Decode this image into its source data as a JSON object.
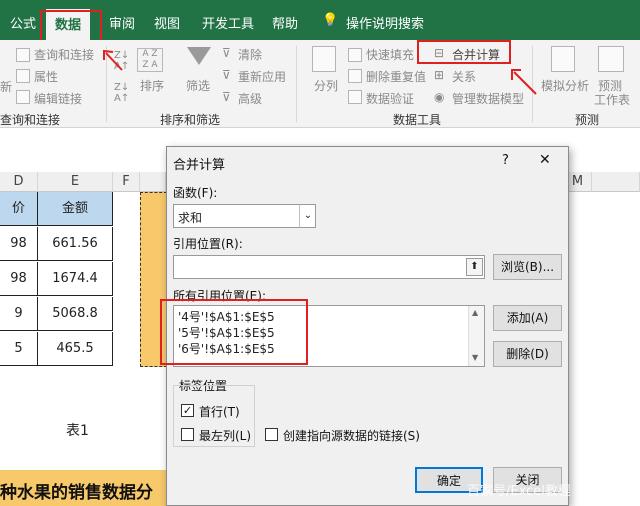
{
  "tabs": [
    {
      "label": "公式"
    },
    {
      "label": "数据"
    },
    {
      "label": "审阅"
    },
    {
      "label": "视图"
    },
    {
      "label": "开发工具"
    },
    {
      "label": "帮助"
    },
    {
      "label": "操作说明搜索"
    }
  ],
  "ribbon": {
    "query": {
      "items": [
        "查询和连接",
        "属性",
        "编辑链接"
      ],
      "group_label": "查询和连接",
      "new_label": "新"
    },
    "sort": {
      "sort_label": "排序",
      "filter_label": "筛选",
      "clear_label": "清除",
      "reapply_label": "重新应用",
      "advanced_label": "高级",
      "group_label": "排序和筛选"
    },
    "tools": {
      "split_label": "分列",
      "flash_fill": "快速填充",
      "remove_dup": "删除重复值",
      "validation": "数据验证",
      "consolidate": "合并计算",
      "relations": "关系",
      "data_model": "管理数据模型",
      "group_label": "数据工具"
    },
    "forecast": {
      "whatif_label": "模拟分析",
      "sheet_label": "预测",
      "sheet_label2": "工作表",
      "group_label": "预测"
    }
  },
  "sheet": {
    "columns": [
      "D",
      "E",
      "F",
      "M"
    ],
    "header_d": "价",
    "header_e": "金额",
    "rows": [
      {
        "d": "98",
        "e": "661.56"
      },
      {
        "d": "98",
        "e": "1674.4"
      },
      {
        "d": "9",
        "e": "5068.8"
      },
      {
        "d": "5",
        "e": "465.5"
      }
    ],
    "table_caption": "表1",
    "title_text": "种水果的销售数据分"
  },
  "dialog": {
    "title": "合并计算",
    "help": "?",
    "close": "✕",
    "function_label": "函数(F):",
    "function_value": "求和",
    "ref_label": "引用位置(R):",
    "ref_value": "",
    "browse_label": "浏览(B)...",
    "all_refs_label": "所有引用位置(E):",
    "all_refs": [
      "'4号'!$A$1:$E$5",
      "'5号'!$A$1:$E$5",
      "'6号'!$A$1:$E$5"
    ],
    "add_label": "添加(A)",
    "delete_label": "删除(D)",
    "label_position": "标签位置",
    "top_row": "首行(T)",
    "top_row_checked": true,
    "left_column": "最左列(L)",
    "left_column_checked": false,
    "link_source": "创建指向源数据的链接(S)",
    "link_source_checked": false,
    "ok_label": "确定",
    "close_label": "关闭"
  },
  "watermark": "百家号/Excel教程",
  "colors": {
    "accent": "#217346",
    "highlight": "#e02020",
    "header_fill": "#bdd7ee",
    "cell_yellow": "#f7c96b"
  }
}
